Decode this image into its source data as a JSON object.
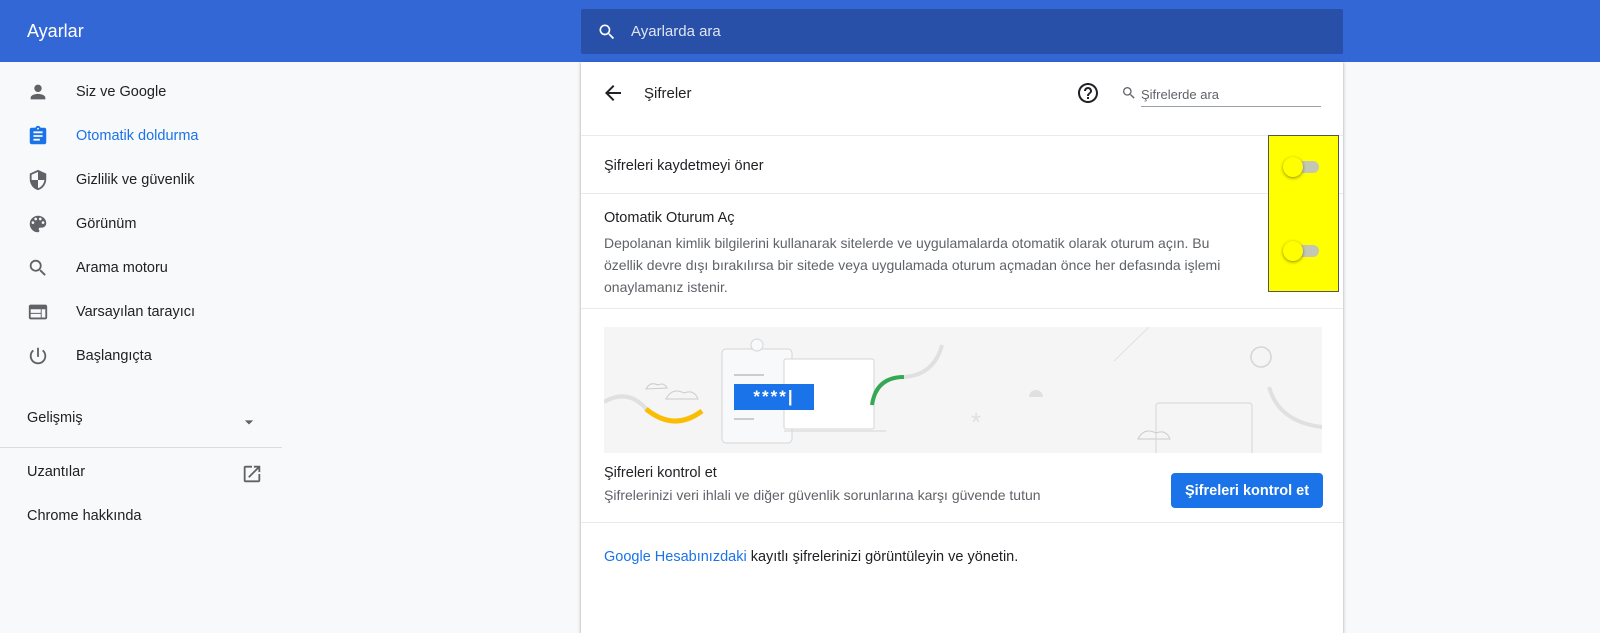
{
  "header": {
    "title": "Ayarlar",
    "search_placeholder": "Ayarlarda ara"
  },
  "sidebar": {
    "items": [
      {
        "label": "Siz ve Google",
        "icon": "person-icon"
      },
      {
        "label": "Otomatik doldurma",
        "icon": "clipboard-icon",
        "active": true
      },
      {
        "label": "Gizlilik ve güvenlik",
        "icon": "shield-icon"
      },
      {
        "label": "Görünüm",
        "icon": "palette-icon"
      },
      {
        "label": "Arama motoru",
        "icon": "search-icon"
      },
      {
        "label": "Varsayılan tarayıcı",
        "icon": "browser-icon"
      },
      {
        "label": "Başlangıçta",
        "icon": "power-icon"
      }
    ],
    "advanced_label": "Gelişmiş",
    "extensions_label": "Uzantılar",
    "about_label": "Chrome hakkında"
  },
  "passwords": {
    "title": "Şifreler",
    "search_placeholder": "Şifrelerde ara",
    "offer_save_label": "Şifreleri kaydetmeyi öner",
    "offer_save_enabled": false,
    "auto_signin_title": "Otomatik Oturum Aç",
    "auto_signin_desc": "Depolanan kimlik bilgilerini kullanarak sitelerde ve uygulamalarda otomatik olarak oturum açın. Bu özellik devre dışı bırakılırsa bir sitede veya uygulamada oturum açmadan önce her defasında işlemi onaylamanız istenir.",
    "auto_signin_enabled": false,
    "illustration_text": "****|",
    "check_title": "Şifreleri kontrol et",
    "check_desc": "Şifrelerinizi veri ihlali ve diğer güvenlik sorunlarına karşı güvende tutun",
    "check_button": "Şifreleri kontrol et",
    "account_link": "Google Hesabınızdaki",
    "account_text": " kayıtlı şifrelerinizi görüntüleyin ve yönetin."
  },
  "colors": {
    "header_blue": "#3367d6",
    "search_bg": "#2850a8",
    "accent": "#1a73e8",
    "highlight": "#ffff00"
  }
}
